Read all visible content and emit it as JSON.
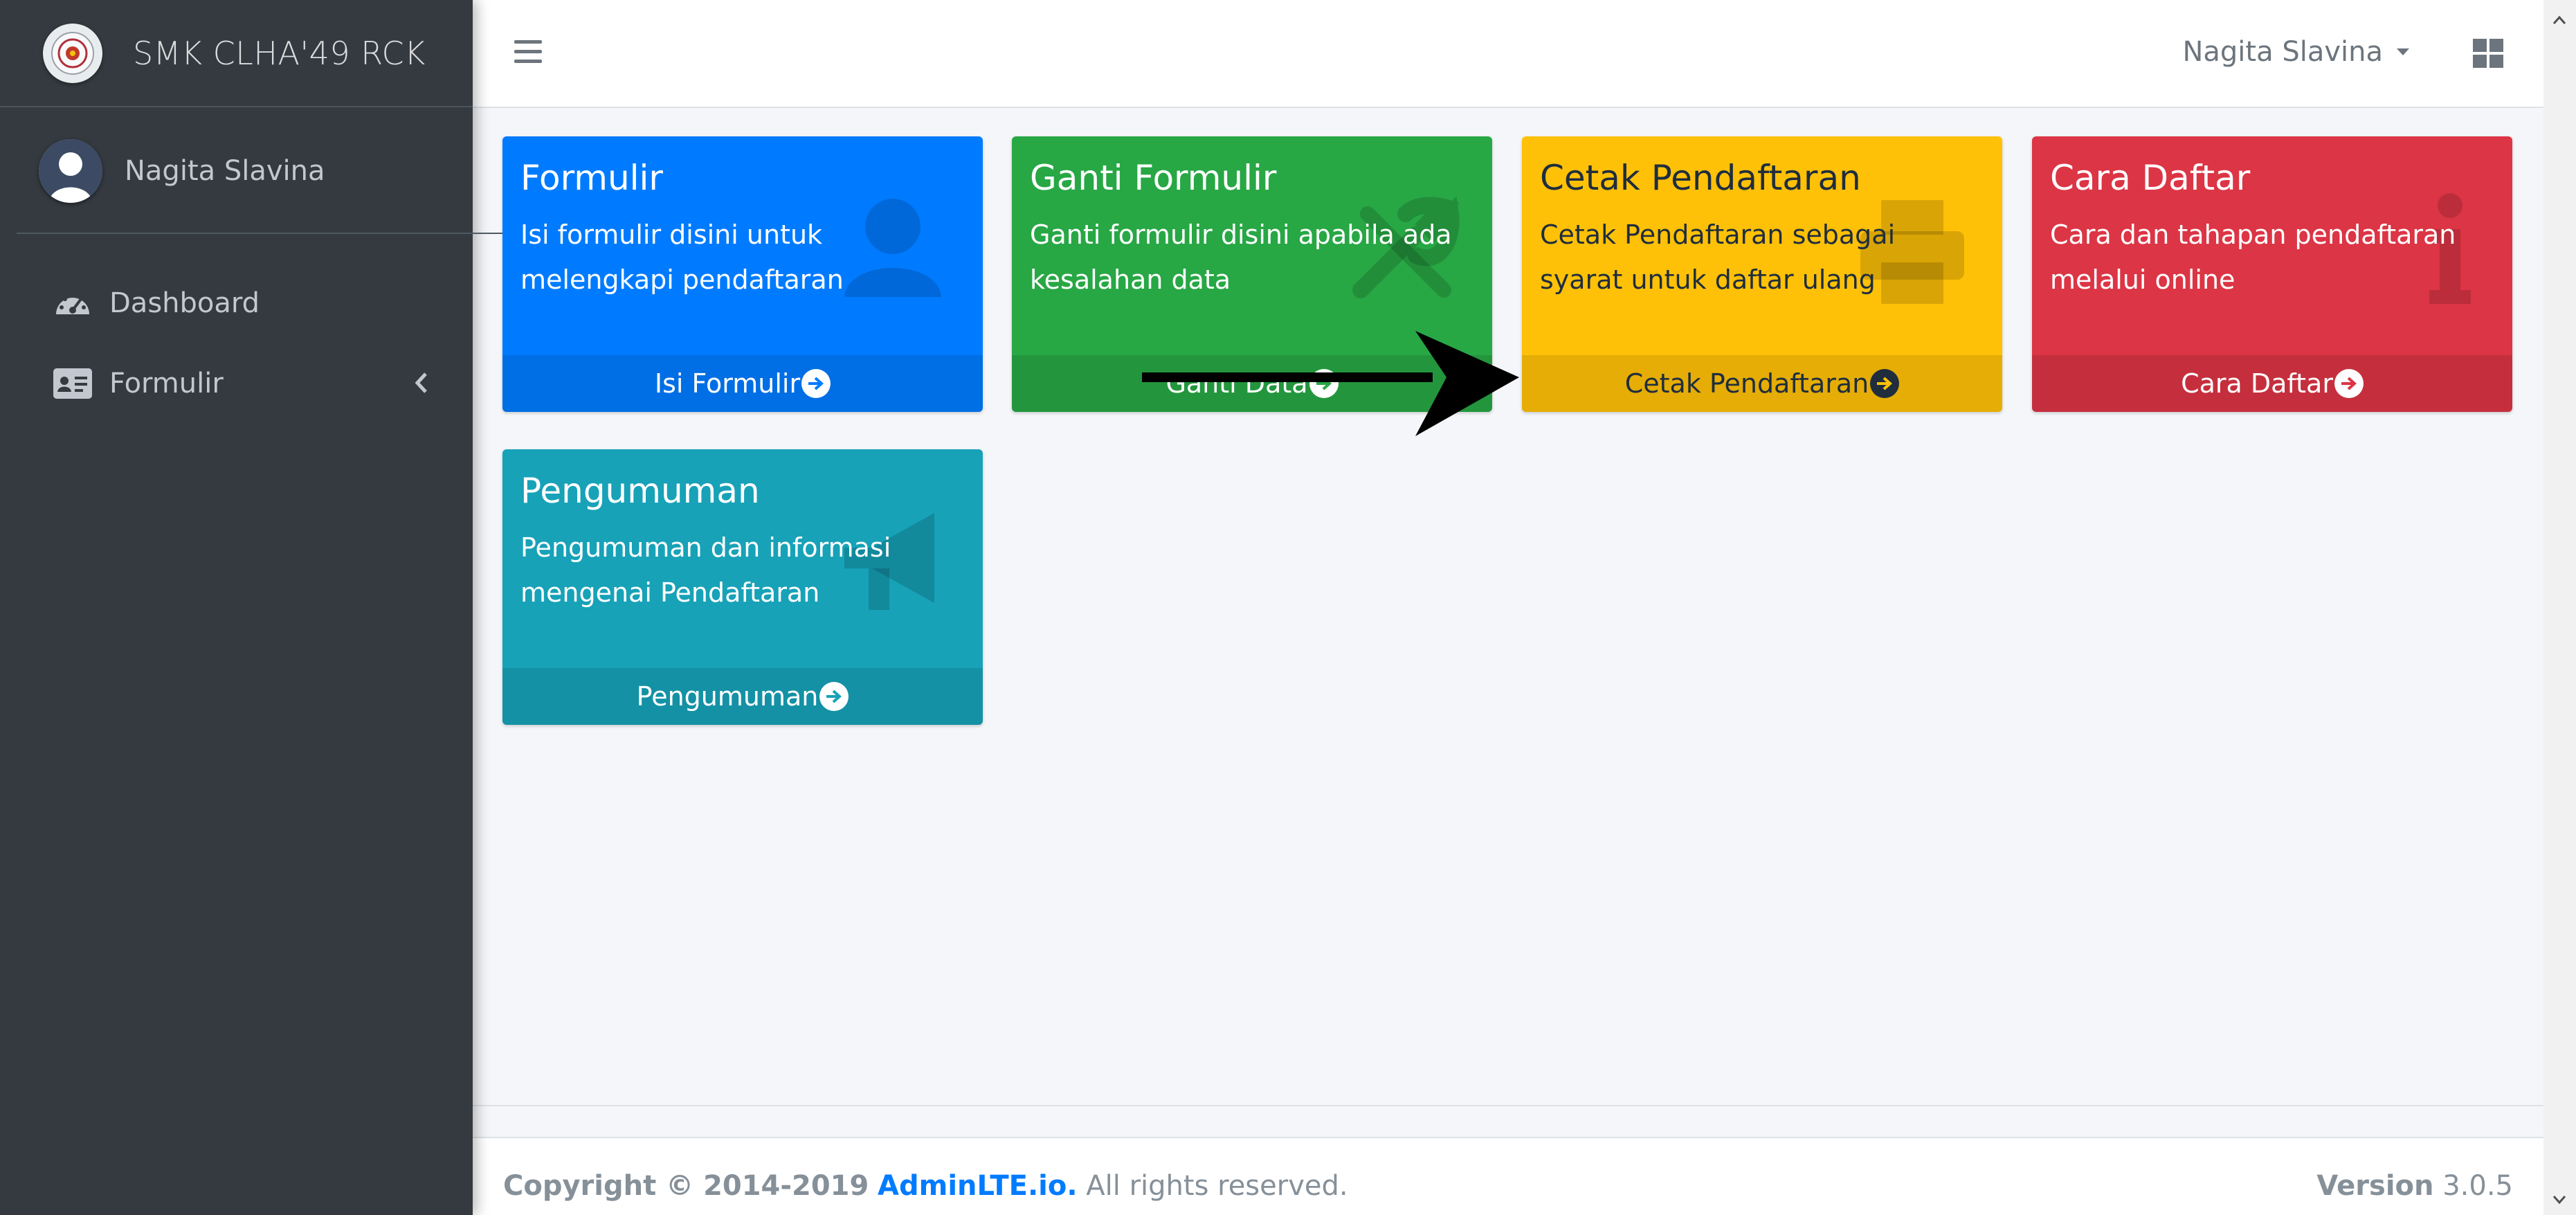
{
  "brand": {
    "title": "SMK CLHA'49 RCK"
  },
  "sidebar": {
    "user_name": "Nagita Slavina",
    "items": [
      {
        "label": "Dashboard",
        "icon": "tachometer-icon"
      },
      {
        "label": "Formulir",
        "icon": "id-card-icon"
      }
    ]
  },
  "header": {
    "user_name": "Nagita Slavina"
  },
  "boxes": [
    {
      "title": "Formulir",
      "text": "Isi formulir disini untuk melengkapi pendaftaran",
      "footer": "Isi Formulir",
      "color": "#007bff",
      "icon": "user-icon"
    },
    {
      "title": "Ganti Formulir",
      "text": "Ganti formulir disini apabila ada kesalahan data",
      "footer": "Ganti Data",
      "color": "#28a745",
      "icon": "tools-icon"
    },
    {
      "title": "Cetak Pendaftaran",
      "text": "Cetak Pendaftaran sebagai syarat untuk daftar ulang",
      "footer": "Cetak Pendaftaran",
      "color": "#ffc107",
      "icon": "print-icon"
    },
    {
      "title": "Cara Daftar",
      "text": "Cara dan tahapan pendaftaran melalui online",
      "footer": "Cara Daftar",
      "color": "#dc3545",
      "icon": "info-icon"
    },
    {
      "title": "Pengumuman",
      "text": "Pengumuman dan informasi mengenai Pendaftaran",
      "footer": "Pengumuman",
      "color": "#17a2b8",
      "icon": "megaphone-icon"
    }
  ],
  "footer": {
    "copyright_prefix": "Copyright © 2014-2019",
    "brand_link": "AdminLTE.io.",
    "rights": "All rights reserved.",
    "version_label": "Version",
    "version_value": "3.0.5"
  }
}
